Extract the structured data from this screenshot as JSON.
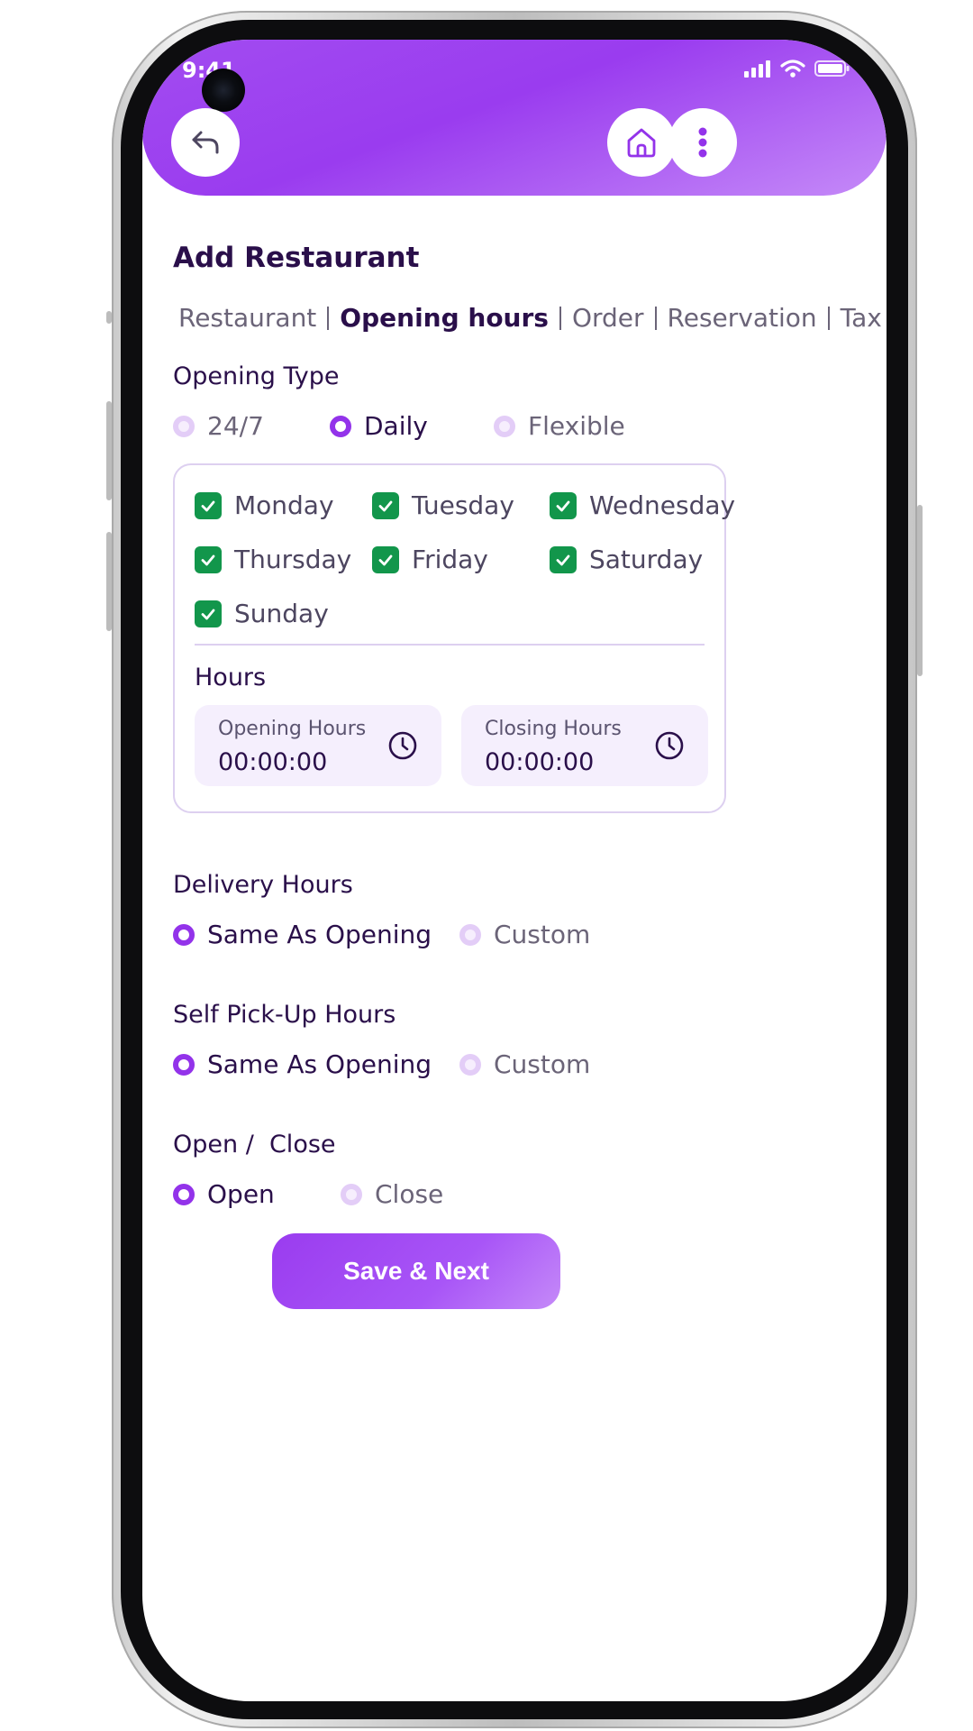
{
  "status_bar": {
    "time": "9:41"
  },
  "page": {
    "title": "Add Restaurant"
  },
  "tabs": [
    {
      "label": "Restaurant",
      "active": false
    },
    {
      "label": "Opening hours",
      "active": true
    },
    {
      "label": "Order",
      "active": false
    },
    {
      "label": "Reservation",
      "active": false
    },
    {
      "label": "Tax",
      "active": false
    }
  ],
  "opening_type": {
    "label": "Opening Type",
    "options": [
      {
        "label": "24/7",
        "selected": false
      },
      {
        "label": "Daily",
        "selected": true
      },
      {
        "label": "Flexible",
        "selected": false
      }
    ]
  },
  "days": [
    {
      "label": "Monday",
      "checked": true
    },
    {
      "label": "Tuesday",
      "checked": true
    },
    {
      "label": "Wednesday",
      "checked": true
    },
    {
      "label": "Thursday",
      "checked": true
    },
    {
      "label": "Friday",
      "checked": true
    },
    {
      "label": "Saturday",
      "checked": true
    },
    {
      "label": "Sunday",
      "checked": true
    }
  ],
  "hours": {
    "label": "Hours",
    "opening": {
      "label": "Opening Hours",
      "value": "00:00:00"
    },
    "closing": {
      "label": "Closing Hours",
      "value": "00:00:00"
    }
  },
  "delivery_hours": {
    "label": "Delivery Hours",
    "options": [
      {
        "label": "Same As Opening",
        "selected": true
      },
      {
        "label": "Custom",
        "selected": false
      }
    ]
  },
  "self_pickup_hours": {
    "label": "Self Pick-Up Hours",
    "options": [
      {
        "label": "Same As Opening",
        "selected": true
      },
      {
        "label": "Custom",
        "selected": false
      }
    ]
  },
  "open_close": {
    "label": "Open /  Close",
    "options": [
      {
        "label": "Open",
        "selected": true
      },
      {
        "label": "Close",
        "selected": false
      }
    ]
  },
  "actions": {
    "save_label": "Save & Next"
  },
  "colors": {
    "accent": "#9333ea",
    "checkbox": "#12964b",
    "title_text": "#2a0f4a",
    "muted_text": "#6b6478"
  }
}
